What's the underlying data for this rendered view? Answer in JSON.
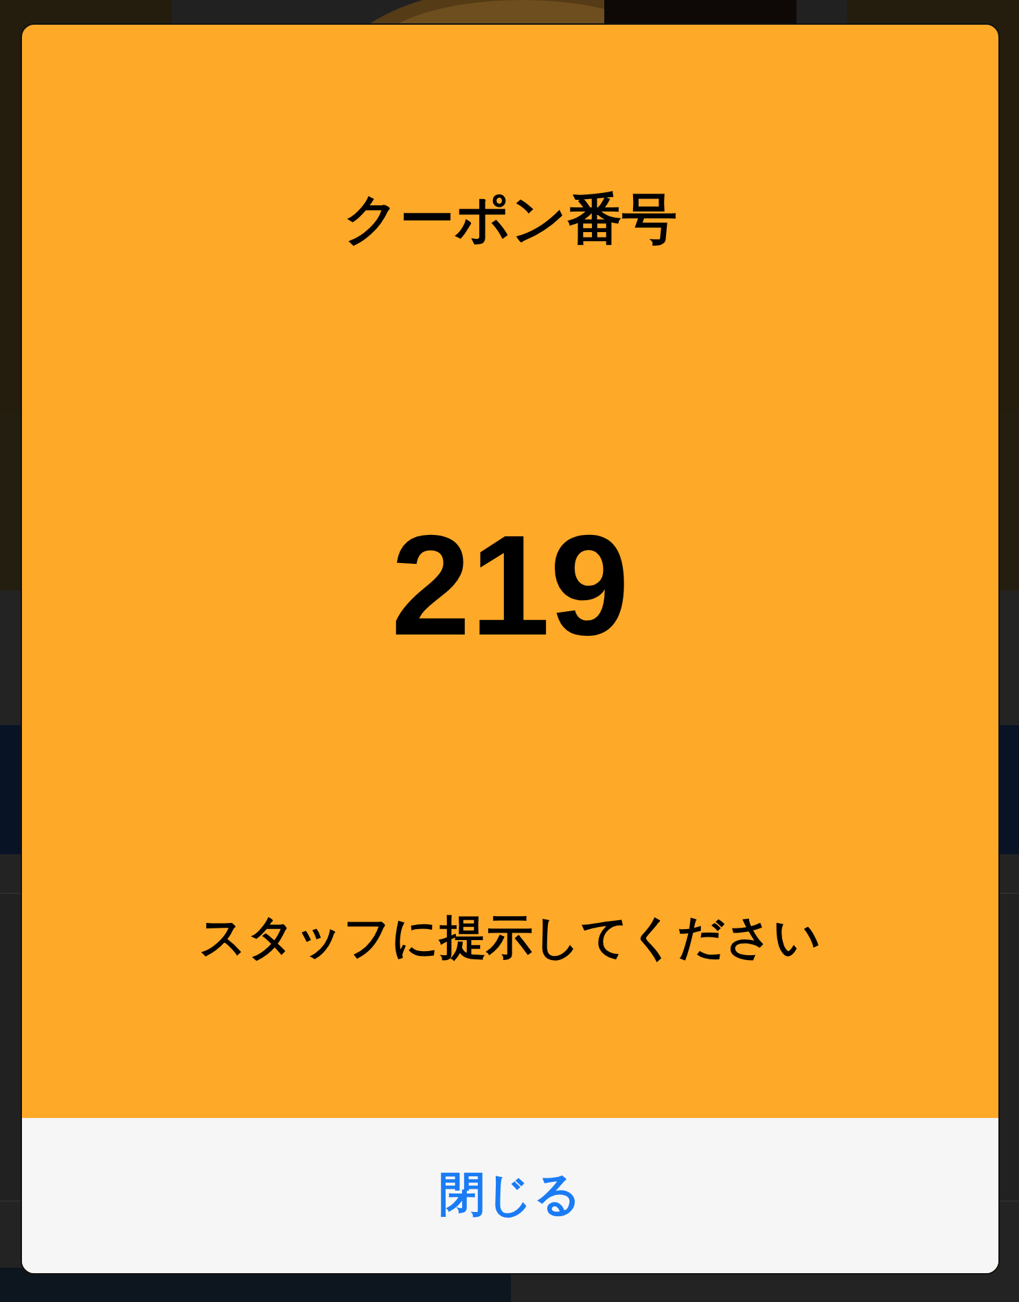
{
  "dialog": {
    "title": "クーポン番号",
    "coupon_number": "219",
    "instruction": "スタッフに提示してください",
    "close_button": "閉じる"
  }
}
